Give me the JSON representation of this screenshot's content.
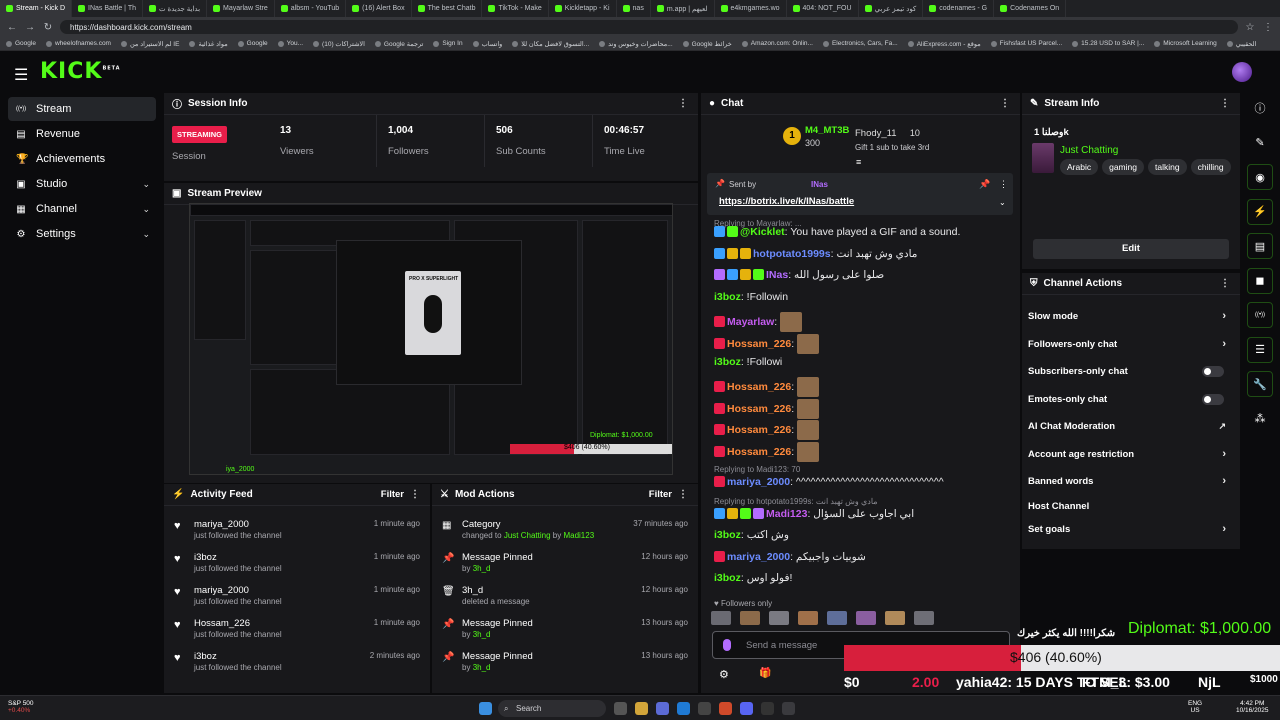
{
  "browser": {
    "tabs": [
      {
        "label": "Stream - Kick D",
        "active": true
      },
      {
        "label": "INas Battle | Th"
      },
      {
        "label": "بداية جديدة ت"
      },
      {
        "label": "Mayarlaw Stre"
      },
      {
        "label": "albsm - YouTub"
      },
      {
        "label": "(16) Alert Box"
      },
      {
        "label": "The best Chatb"
      },
      {
        "label": "TikTok - Make"
      },
      {
        "label": "Kickletapp - Ki"
      },
      {
        "label": "nas"
      },
      {
        "label": "m.app | لعيهم"
      },
      {
        "label": "e4kmgames.wo"
      },
      {
        "label": "404: NOT_FOU"
      },
      {
        "label": "كود تيمز عربي"
      },
      {
        "label": "codenames - G"
      },
      {
        "label": "Codenames On"
      }
    ],
    "url": "https://dashboard.kick.com/stream",
    "bookmarks": [
      "Google",
      "wheelofnames.com",
      "لم الاستيراد من IE",
      "مواد غذائية",
      "Google",
      "You...",
      "الاشتراكات (10)",
      "Google ترجمة",
      "Sign In",
      "واتساب",
      "التسوق لافضل مكان للا...",
      "محاضرات وخيوس وند...",
      "Google خرائط",
      "Amazon.com: Onlin...",
      "Electronics, Cars, Fa...",
      "AliExpress.com - موقع",
      "Fishsfast US Parcel...",
      "15.28 USD to SAR |...",
      "Microsoft Learning",
      "الحقيبي"
    ]
  },
  "header": {
    "logo": "KICK",
    "logo_sup": "BETA",
    "menu_icon": "menu-icon"
  },
  "nav": {
    "items": [
      {
        "label": "Stream",
        "icon": "stream-icon",
        "active": true,
        "chevron": false
      },
      {
        "label": "Revenue",
        "icon": "revenue-icon",
        "chevron": false
      },
      {
        "label": "Achievements",
        "icon": "trophy-icon",
        "chevron": false
      },
      {
        "label": "Studio",
        "icon": "studio-icon",
        "chevron": true
      },
      {
        "label": "Channel",
        "icon": "channel-icon",
        "chevron": true
      },
      {
        "label": "Settings",
        "icon": "gear-icon",
        "chevron": true
      }
    ]
  },
  "session": {
    "title": "Session Info",
    "status": "STREAMING",
    "status_label": "Session",
    "stats": [
      {
        "value": "13",
        "label": "Viewers"
      },
      {
        "value": "1,004",
        "label": "Followers"
      },
      {
        "value": "506",
        "label": "Sub Counts"
      },
      {
        "value": "00:46:57",
        "label": "Time Live"
      }
    ]
  },
  "preview": {
    "title": "Stream Preview",
    "overlay_text": "PRO X SUPERLIGHT",
    "overlay_diplomat": "Diplomat: $1,000.00",
    "overlay_progress": "$406 (40.60%)",
    "overlay_user": "iya_2000"
  },
  "activity": {
    "title": "Activity Feed",
    "filter": "Filter",
    "rows": [
      {
        "name": "mariya_2000",
        "desc": "just followed the channel",
        "time": "1 minute ago"
      },
      {
        "name": "i3boz",
        "desc": "just followed the channel",
        "time": "1 minute ago"
      },
      {
        "name": "mariya_2000",
        "desc": "just followed the channel",
        "time": "1 minute ago"
      },
      {
        "name": "Hossam_226",
        "desc": "just followed the channel",
        "time": "1 minute ago"
      },
      {
        "name": "i3boz",
        "desc": "just followed the channel",
        "time": "2 minutes ago"
      }
    ]
  },
  "mod": {
    "title": "Mod Actions",
    "filter": "Filter",
    "rows": [
      {
        "icon": "calendar-icon",
        "title": "Category",
        "pre": "changed to",
        "hl1": "Just Chatting",
        "mid": "by",
        "hl2": "Madi123",
        "time": "37 minutes ago"
      },
      {
        "icon": "pin-icon",
        "title": "Message Pinned",
        "pre": "by",
        "hl1": "3h_d",
        "mid": "",
        "hl2": "",
        "time": "12 hours ago"
      },
      {
        "icon": "trash-icon",
        "title": "3h_d",
        "pre": "deleted a message",
        "hl1": "",
        "mid": "",
        "hl2": "",
        "time": "12 hours ago"
      },
      {
        "icon": "pin-icon",
        "title": "Message Pinned",
        "pre": "by",
        "hl1": "3h_d",
        "mid": "",
        "hl2": "",
        "time": "13 hours ago"
      },
      {
        "icon": "pin-icon",
        "title": "Message Pinned",
        "pre": "by",
        "hl1": "3h_d",
        "mid": "",
        "hl2": "",
        "time": "13 hours ago"
      }
    ]
  },
  "chat": {
    "title": "Chat",
    "top_gifter": {
      "rank": "1",
      "name": "M4_MT3B",
      "amount": "300"
    },
    "gift": {
      "name": "Fhody_11",
      "amount": "10",
      "text": "Gift 1 sub to take 3rd"
    },
    "pinned": {
      "sent_by": "Sent by",
      "sender": "INas",
      "link": "https://botrix.live/k/INas/battle"
    },
    "replying1": "Replying to Mayarlaw: ...",
    "messages": [
      {
        "user": "@Kicklet",
        "text": ": You have played a GIF and a sound.",
        "color": "#53fc18"
      },
      {
        "user": "hotpotato1999s",
        "text": ": مادي وش تهبد انت",
        "color": "#6c8cff"
      },
      {
        "user": "INas",
        "text": ": صلوا على رسول الله",
        "color": "#b36cff"
      },
      {
        "user": "i3boz",
        "text": ": !Followin",
        "color": "#53fc18"
      },
      {
        "user": "Mayarlaw",
        "text": ":",
        "color": "#c45cf0"
      },
      {
        "user": "Hossam_226",
        "text": ":",
        "color": "#ff8a3d"
      },
      {
        "user": "i3boz",
        "text": ": !Followi",
        "color": "#53fc18"
      },
      {
        "user": "Hossam_226",
        "text": ":",
        "color": "#ff8a3d"
      },
      {
        "user": "Hossam_226",
        "text": ":",
        "color": "#ff8a3d"
      },
      {
        "user": "Hossam_226",
        "text": ":",
        "color": "#ff8a3d"
      },
      {
        "user": "Hossam_226",
        "text": ":",
        "color": "#ff8a3d"
      },
      {
        "user": "mariya_2000",
        "text": ": ^^^^^^^^^^^^^^^^^^^^^^^^^^^^^^",
        "color": "#6c8cff"
      },
      {
        "user": "Madi123",
        "text": ": ابي اجاوب على السؤال",
        "color": "#c45cf0"
      },
      {
        "user": "i3boz",
        "text": ": وش اكتب",
        "color": "#53fc18"
      },
      {
        "user": "mariya_2000",
        "text": ": شوبيات واجبيكم",
        "color": "#6c8cff"
      },
      {
        "user": "i3boz",
        "text": ": فولو اوس!",
        "color": "#53fc18"
      }
    ],
    "replying2": "Replying to Madi123: 70",
    "replying3": "Replying to hotpotato1999s: مادي وش تهبد انت",
    "followers_only": "Followers only",
    "placeholder": "Send a message"
  },
  "streaminfo": {
    "title": "Stream Info",
    "stream_title": "وصلنا 1k",
    "category": "Just Chatting",
    "tags": [
      "Arabic",
      "gaming",
      "talking",
      "chilling"
    ],
    "edit": "Edit"
  },
  "actions": {
    "title": "Channel Actions",
    "items": [
      {
        "label": "Slow mode",
        "kind": "chevron"
      },
      {
        "label": "Followers-only chat",
        "kind": "chevron"
      },
      {
        "label": "Subscribers-only chat",
        "kind": "toggle"
      },
      {
        "label": "Emotes-only chat",
        "kind": "toggle"
      },
      {
        "label": "AI Chat Moderation",
        "kind": "external"
      },
      {
        "label": "Account age restriction",
        "kind": "chevron"
      },
      {
        "label": "Banned words",
        "kind": "chevron"
      },
      {
        "label": "Host Channel",
        "kind": "none"
      },
      {
        "label": "Set goals",
        "kind": "chevron"
      }
    ]
  },
  "overlay": {
    "arabic": "شكرا!!!! الله يكثر خيرك",
    "diplomat": "Diplomat: $1,000.00",
    "progress": "$406 (40.60%)",
    "progress_fraction": 0.406,
    "ticker": [
      "$0",
      "2.00",
      "yahia42: 15 DAYS TO SEL",
      "FTM_3: $3.00",
      "NjL",
      "$1000"
    ]
  },
  "taskbar": {
    "stock_name": "S&P 500",
    "stock_change": "+0.40%",
    "search": "Search",
    "lang": "ENG",
    "region": "US",
    "time": "4:42 PM",
    "date": "10/16/2025"
  },
  "colors": {
    "accent": "#53fc18",
    "danger": "#e91e4a",
    "panel": "#18181b"
  }
}
